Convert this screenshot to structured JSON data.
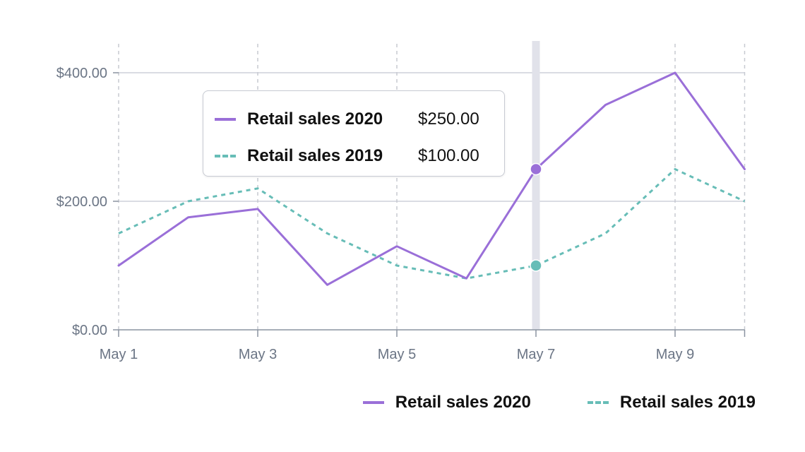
{
  "chart_data": {
    "type": "line",
    "x": [
      "May 1",
      "May 2",
      "May 3",
      "May 4",
      "May 5",
      "May 6",
      "May 7",
      "May 8",
      "May 9",
      "May 10"
    ],
    "x_tick_labels": [
      "May 1",
      "May 3",
      "May 5",
      "May 7",
      "May 9"
    ],
    "y_tick_labels": [
      "$0.00",
      "$200.00",
      "$400.00"
    ],
    "y_ticks": [
      0,
      200,
      400
    ],
    "ylim": [
      0,
      400
    ],
    "grid": true,
    "legend_position": "bottom-right",
    "series": [
      {
        "name": "Retail sales 2020",
        "color": "#9a6fd8",
        "style": "solid",
        "values": [
          100,
          175,
          188,
          70,
          130,
          80,
          250,
          350,
          400,
          250
        ]
      },
      {
        "name": "Retail sales 2019",
        "color": "#67bdb7",
        "style": "dashed",
        "values": [
          150,
          200,
          220,
          150,
          100,
          80,
          100,
          150,
          250,
          200
        ]
      }
    ],
    "hover": {
      "x": "May 7",
      "index": 6,
      "rows": [
        {
          "name": "Retail sales 2020",
          "value": "$250.00"
        },
        {
          "name": "Retail sales 2019",
          "value": "$100.00"
        }
      ]
    }
  }
}
